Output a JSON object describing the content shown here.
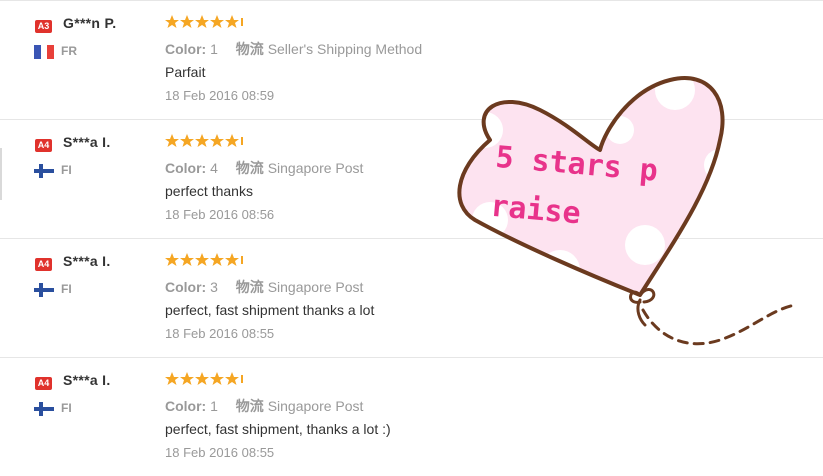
{
  "reviews": [
    {
      "level": "A3",
      "name": "G***n P.",
      "country": "FR",
      "flag": "france",
      "color_label": "Color:",
      "color_value": "1",
      "ship_label": "物流",
      "ship_value": "Seller's Shipping Method",
      "text": "Parfait",
      "date": "18 Feb 2016 08:59",
      "stars": 5
    },
    {
      "level": "A4",
      "name": "S***a I.",
      "country": "FI",
      "flag": "finland",
      "color_label": "Color:",
      "color_value": "4",
      "ship_label": "物流",
      "ship_value": "Singapore Post",
      "text": "perfect thanks",
      "date": "18 Feb 2016 08:56",
      "stars": 5
    },
    {
      "level": "A4",
      "name": "S***a I.",
      "country": "FI",
      "flag": "finland",
      "color_label": "Color:",
      "color_value": "3",
      "ship_label": "物流",
      "ship_value": "Singapore Post",
      "text": "perfect, fast shipment thanks a lot",
      "date": "18 Feb 2016 08:55",
      "stars": 5
    },
    {
      "level": "A4",
      "name": "S***a I.",
      "country": "FI",
      "flag": "finland",
      "color_label": "Color:",
      "color_value": "1",
      "ship_label": "物流",
      "ship_value": "Singapore Post",
      "text": "perfect, fast shipment, thanks a lot :)",
      "date": "18 Feb 2016 08:55",
      "stars": 5
    }
  ],
  "sticker": {
    "line1": "5 stars p",
    "line2": "raise",
    "heart_color": "#fde3f0",
    "text_color": "#e8338b",
    "outline_color": "#6b3a1f"
  },
  "colors": {
    "star": "#f5a623",
    "badge": "#e0322c"
  }
}
